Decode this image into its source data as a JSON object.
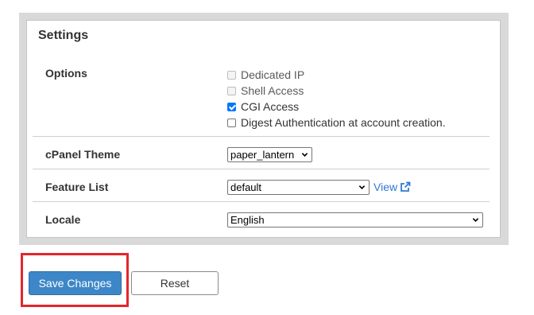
{
  "settings": {
    "title": "Settings",
    "options": {
      "label": "Options",
      "items": [
        {
          "label": "Dedicated IP",
          "checked": false,
          "disabled": true
        },
        {
          "label": "Shell Access",
          "checked": false,
          "disabled": true
        },
        {
          "label": "CGI Access",
          "checked": true,
          "disabled": false
        },
        {
          "label": "Digest Authentication at account creation.",
          "checked": false,
          "disabled": false
        }
      ]
    },
    "cpanel_theme": {
      "label": "cPanel Theme",
      "value": "paper_lantern"
    },
    "feature_list": {
      "label": "Feature List",
      "value": "default",
      "link": "View"
    },
    "locale": {
      "label": "Locale",
      "value": "English"
    }
  },
  "actions": {
    "save_label": "Save Changes",
    "reset_label": "Reset"
  },
  "colors": {
    "primary": "#3d87c8",
    "link": "#2f7ad6",
    "highlight": "#e3262e",
    "checkbox": "#0075ff"
  }
}
